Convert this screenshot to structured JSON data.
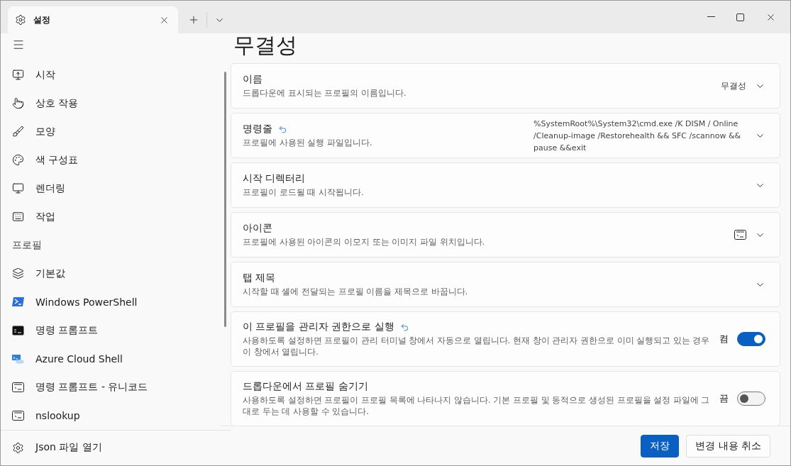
{
  "tab": {
    "title": "설정"
  },
  "sidebar": {
    "items": [
      {
        "label": "시작",
        "kind": "start"
      },
      {
        "label": "상호 작용",
        "kind": "pointer"
      },
      {
        "label": "모양",
        "kind": "brush"
      },
      {
        "label": "색 구성표",
        "kind": "palette"
      },
      {
        "label": "렌더링",
        "kind": "screen"
      },
      {
        "label": "작업",
        "kind": "keyboard"
      }
    ],
    "section": "프로필",
    "profiles": [
      {
        "label": "기본값",
        "kind": "layers"
      },
      {
        "label": "Windows PowerShell",
        "kind": "powershell"
      },
      {
        "label": "명령 프롬프트",
        "kind": "cmd"
      },
      {
        "label": "Azure Cloud Shell",
        "kind": "azure"
      },
      {
        "label": "명령 프롬프트 - 유니코드",
        "kind": "console"
      },
      {
        "label": "nslookup",
        "kind": "console"
      }
    ],
    "footer": {
      "label": "Json 파일 열기"
    }
  },
  "page": {
    "title": "무결성"
  },
  "cards": [
    {
      "kind": "dropdown",
      "title": "이름",
      "description": "드롭다운에 표시되는 프로필의 이름입니다.",
      "modified": false,
      "value": "무결성"
    },
    {
      "kind": "dropdown",
      "title": "명령줄",
      "description": "프로필에 사용된 실행 파일입니다.",
      "modified": true,
      "value": "%SystemRoot%\\System32\\cmd.exe /K DISM / Online /Cleanup-image /Restorehealth && SFC /scannow && pause &&exit"
    },
    {
      "kind": "dropdown",
      "title": "시작 디렉터리",
      "description": "프로필이 로드될 때 시작됩니다.",
      "modified": false
    },
    {
      "kind": "dropdown",
      "title": "아이콘",
      "description": "프로필에 사용된 아이콘의 이모지 또는 이미지 파일 위치입니다.",
      "modified": false,
      "preview_icon": true
    },
    {
      "kind": "dropdown",
      "title": "탭 제목",
      "description": "시작할 때 셸에 전달되는 프로필 이름을 제목으로 바꿉니다.",
      "modified": false
    },
    {
      "kind": "toggle",
      "title": "이 프로필을 관리자 권한으로 실행",
      "description": "사용하도록 설정하면 프로필이 관리 터미널 창에서 자동으로 열립니다. 현재 창이 관리자 권한으로 이미 실행되고 있는 경우 이 창에서 열립니다.",
      "modified": true,
      "on": true,
      "state_label": "켬"
    },
    {
      "kind": "toggle",
      "title": "드롭다운에서 프로필 숨기기",
      "description": "사용하도록 설정하면 프로필이 프로필 목록에 나타나지 않습니다. 기본 프로필 및 동적으로 생성된 프로필을 설정 파일에 그대로 두는 데 사용할 수 있습니다.",
      "modified": false,
      "on": false,
      "state_label": "끔"
    }
  ],
  "buttons": [
    {
      "label": "저장",
      "primary": true
    },
    {
      "label": "변경 내용 취소",
      "primary": false
    }
  ]
}
